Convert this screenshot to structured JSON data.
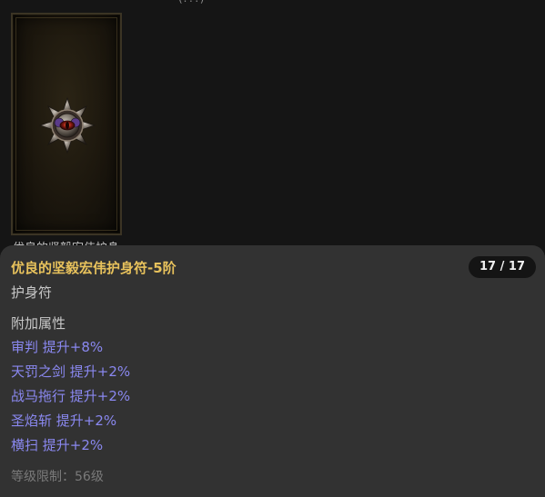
{
  "header": {
    "clipped_text": "(???)"
  },
  "item_card": {
    "image_icon": "amulet-icon",
    "caption": "优良的坚毅宏伟护身"
  },
  "tooltip": {
    "name": "优良的坚毅宏伟护身符-5阶",
    "counter": "17 / 17",
    "type": "护身符",
    "attributes_heading": "附加属性",
    "attributes": [
      "审判 提升+8%",
      "天罚之剑 提升+2%",
      "战马拖行 提升+2%",
      "圣焰斩 提升+2%",
      "横扫 提升+2%"
    ],
    "level_requirement": "等级限制：56级"
  },
  "colors": {
    "name": "#e8c25c",
    "attribute": "#8a88f0",
    "panel": "#323232",
    "background": "#151515"
  }
}
